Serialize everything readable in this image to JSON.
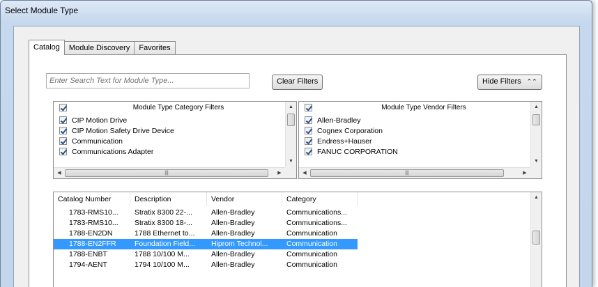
{
  "window": {
    "title": "Select Module Type"
  },
  "tabs": [
    {
      "label": "Catalog",
      "active": true
    },
    {
      "label": "Module Discovery",
      "active": false
    },
    {
      "label": "Favorites",
      "active": false
    }
  ],
  "search": {
    "placeholder": "Enter Search Text for Module Type..."
  },
  "buttons": {
    "clear_filters": "Clear Filters",
    "hide_filters": "Hide Filters",
    "hide_filters_icon": "double-chevron-up"
  },
  "category_filters": {
    "title": "Module Type Category Filters",
    "items": [
      {
        "label": "CIP Motion Drive",
        "checked": true
      },
      {
        "label": "CIP Motion Safety Drive Device",
        "checked": true
      },
      {
        "label": "Communication",
        "checked": true
      },
      {
        "label": "Communications Adapter",
        "checked": true
      }
    ]
  },
  "vendor_filters": {
    "title": "Module Type Vendor Filters",
    "items": [
      {
        "label": "Allen-Bradley",
        "checked": true
      },
      {
        "label": "Cognex Corporation",
        "checked": true
      },
      {
        "label": "Endress+Hauser",
        "checked": true
      },
      {
        "label": "FANUC CORPORATION",
        "checked": true
      }
    ]
  },
  "catalog_table": {
    "columns": [
      "Catalog Number",
      "Description",
      "Vendor",
      "Category"
    ],
    "rows": [
      {
        "catalog": "1783-RMS10...",
        "description": "Stratix 8300 22-...",
        "vendor": "Allen-Bradley",
        "category": "Communications...",
        "selected": false
      },
      {
        "catalog": "1783-RMS10...",
        "description": "Stratix 8300 18-...",
        "vendor": "Allen-Bradley",
        "category": "Communications...",
        "selected": false
      },
      {
        "catalog": "1788-EN2DN",
        "description": "1788 Ethernet to...",
        "vendor": "Allen-Bradley",
        "category": "Communication",
        "selected": false
      },
      {
        "catalog": "1788-EN2FFR",
        "description": "Foundation Field...",
        "vendor": "Hiprom Technol...",
        "category": "Communication",
        "selected": true
      },
      {
        "catalog": "1788-ENBT",
        "description": "1788 10/100 M...",
        "vendor": "Allen-Bradley",
        "category": "Communication",
        "selected": false
      },
      {
        "catalog": "1794-AENT",
        "description": "1794 10/100 M...",
        "vendor": "Allen-Bradley",
        "category": "Communication",
        "selected": false
      }
    ]
  },
  "colors": {
    "selection": "#3399ff",
    "frame": "#c6d8ee"
  }
}
